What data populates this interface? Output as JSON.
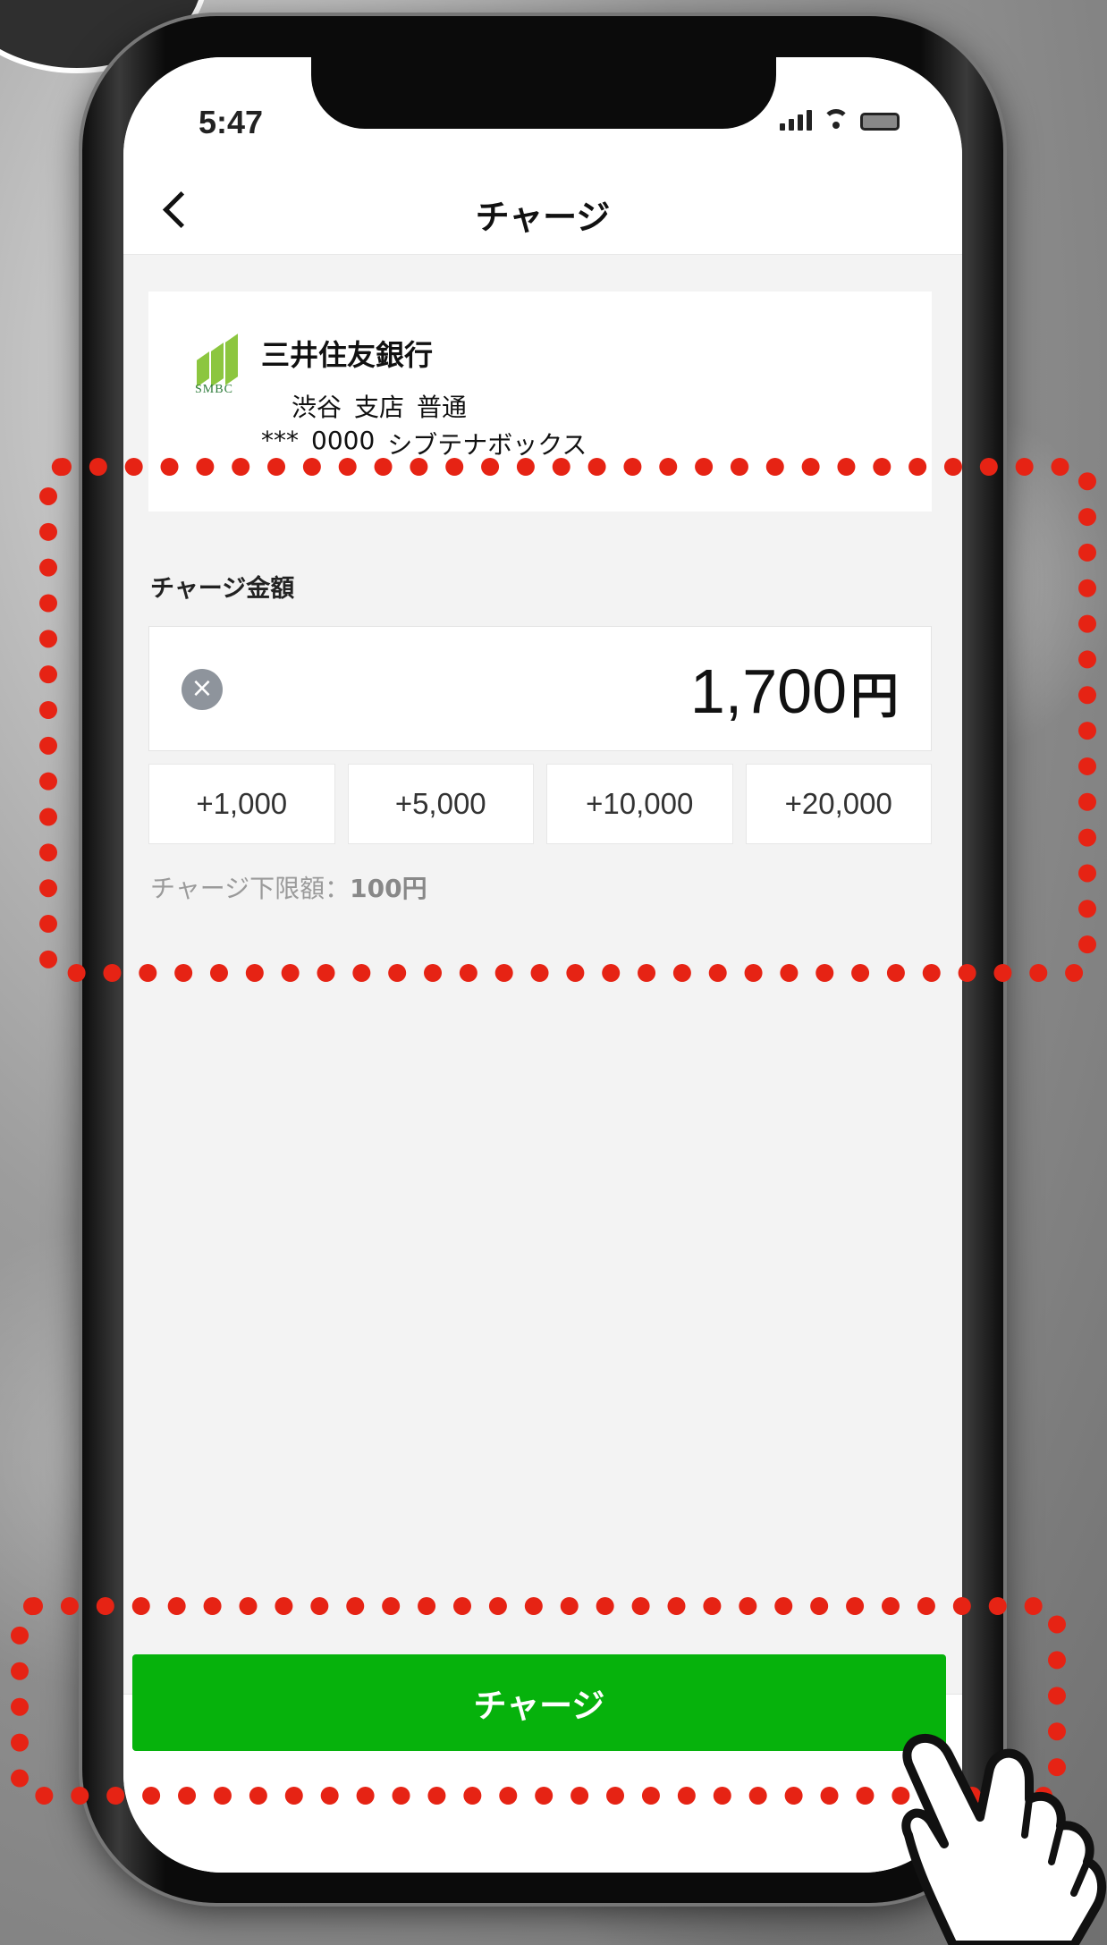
{
  "status_bar": {
    "time": "5:47",
    "icons": [
      "signal-icon",
      "wifi-icon",
      "battery-icon"
    ]
  },
  "nav": {
    "title": "チャージ",
    "back_icon": "chevron-left-icon"
  },
  "bank": {
    "logo_icon": "smbc-logo",
    "logo_label": "SMBC",
    "name": "三井住友銀行",
    "branch": "渋谷",
    "branch_suffix": "支店",
    "account_type": "普通",
    "account_mask": "***",
    "account_number": "0000",
    "account_holder": "シブテナボックス"
  },
  "charge": {
    "section_label": "チャージ金額",
    "amount": "1,700",
    "currency": "円",
    "clear_symbol": "×",
    "quick_amounts": [
      "+1,000",
      "+5,000",
      "+10,000",
      "+20,000"
    ],
    "min_note_label": "チャージ下限額：",
    "min_note_value": "100円"
  },
  "footer": {
    "charge_button_label": "チャージ"
  },
  "colors": {
    "accent_green": "#06b20c",
    "highlight_red": "#e62314",
    "smbc_green": "#8cc63f"
  }
}
